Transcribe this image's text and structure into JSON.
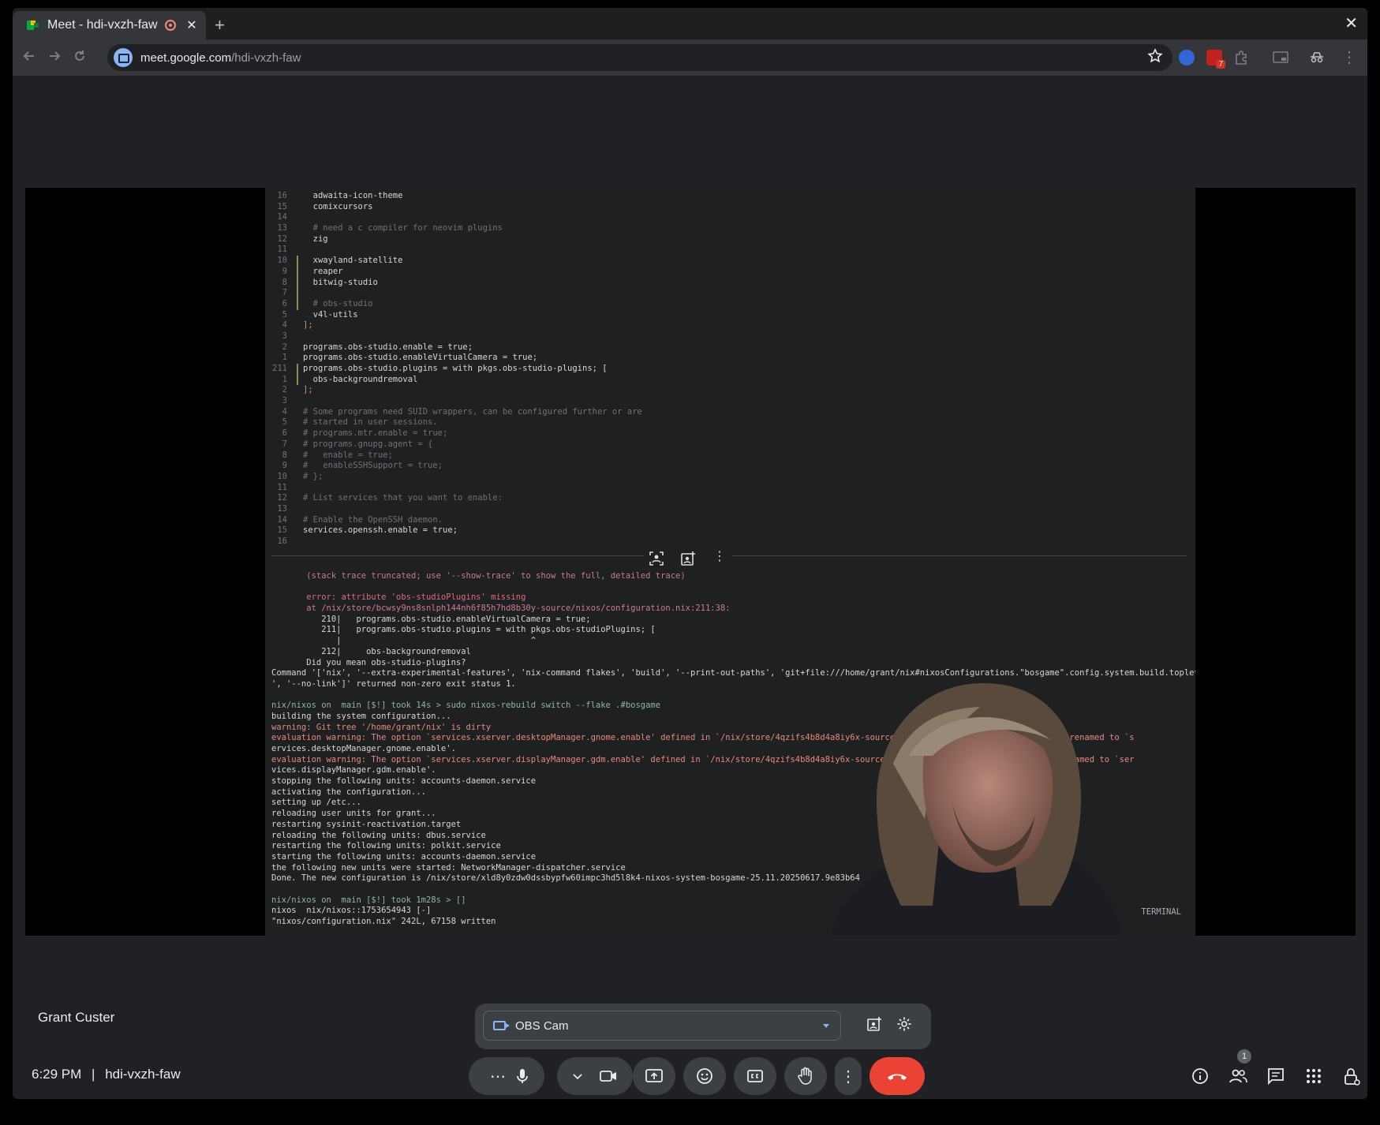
{
  "browser": {
    "tab_title": "Meet - hdi-vxzh-faw",
    "tab_close": "✕",
    "new_tab": "+",
    "window_close": "✕",
    "url_host": "meet.google.com",
    "url_path": "/hdi-vxzh-faw",
    "extension_badge": "7"
  },
  "editor": {
    "lines": [
      {
        "n": "16",
        "t": "  adwaita-icon-theme",
        "c": "",
        "m": false
      },
      {
        "n": "15",
        "t": "  comixcursors",
        "c": "",
        "m": false
      },
      {
        "n": "14",
        "t": "",
        "c": "",
        "m": false
      },
      {
        "n": "13",
        "t": "  # need a c compiler for neovim plugins",
        "c": "comment",
        "m": false
      },
      {
        "n": "12",
        "t": "  zig",
        "c": "",
        "m": false
      },
      {
        "n": "11",
        "t": "",
        "c": "",
        "m": false
      },
      {
        "n": "10",
        "t": "  xwayland-satellite",
        "c": "",
        "m": true
      },
      {
        "n": "9",
        "t": "  reaper",
        "c": "",
        "m": true
      },
      {
        "n": "8",
        "t": "  bitwig-studio",
        "c": "",
        "m": true
      },
      {
        "n": "7",
        "t": "",
        "c": "",
        "m": true
      },
      {
        "n": "6",
        "t": "  # obs-studio",
        "c": "comment",
        "m": true
      },
      {
        "n": "5",
        "t": "  v4l-utils",
        "c": "",
        "m": false
      },
      {
        "n": "4",
        "t": "];",
        "c": "kw",
        "m": false
      },
      {
        "n": "3",
        "t": "",
        "c": "",
        "m": false
      },
      {
        "n": "2",
        "t": "programs.obs-studio.enable = true;",
        "c": "",
        "m": false
      },
      {
        "n": "1",
        "t": "programs.obs-studio.enableVirtualCamera = true;",
        "c": "",
        "m": false
      },
      {
        "n": "211",
        "t": "programs.obs-studio.plugins = with pkgs.obs-studio-plugins; [",
        "c": "",
        "m": true
      },
      {
        "n": "1",
        "t": "  obs-backgroundremoval",
        "c": "",
        "m": true
      },
      {
        "n": "2",
        "t": "];",
        "c": "kw",
        "m": false
      },
      {
        "n": "3",
        "t": "",
        "c": "",
        "m": false
      },
      {
        "n": "4",
        "t": "# Some programs need SUID wrappers, can be configured further or are",
        "c": "comment",
        "m": false
      },
      {
        "n": "5",
        "t": "# started in user sessions.",
        "c": "comment",
        "m": false
      },
      {
        "n": "6",
        "t": "# programs.mtr.enable = true;",
        "c": "comment",
        "m": false
      },
      {
        "n": "7",
        "t": "# programs.gnupg.agent = {",
        "c": "comment",
        "m": false
      },
      {
        "n": "8",
        "t": "#   enable = true;",
        "c": "comment",
        "m": false
      },
      {
        "n": "9",
        "t": "#   enableSSHSupport = true;",
        "c": "comment",
        "m": false
      },
      {
        "n": "10",
        "t": "# };",
        "c": "comment",
        "m": false
      },
      {
        "n": "11",
        "t": "",
        "c": "",
        "m": false
      },
      {
        "n": "12",
        "t": "# List services that you want to enable:",
        "c": "comment",
        "m": false
      },
      {
        "n": "13",
        "t": "",
        "c": "",
        "m": false
      },
      {
        "n": "14",
        "t": "# Enable the OpenSSH daemon.",
        "c": "comment",
        "m": false
      },
      {
        "n": "15",
        "t": "services.openssh.enable = true;",
        "c": "",
        "m": false
      },
      {
        "n": "16",
        "t": "",
        "c": "",
        "m": false
      }
    ]
  },
  "terminal": {
    "label": "TERMINAL",
    "lines": [
      {
        "t": "       (stack trace truncated; use '--show-trace' to show the full, detailed trace)",
        "c": "trunc"
      },
      {
        "t": "",
        "c": ""
      },
      {
        "t": "       error: attribute 'obs-studioPlugins' missing",
        "c": "err"
      },
      {
        "t": "       at /nix/store/bcwsy9ns8snlph144nh6f85h7hd8b30y-source/nixos/configuration.nix:211:38:",
        "c": "path"
      },
      {
        "t": "          210|   programs.obs-studio.enableVirtualCamera = true;",
        "c": ""
      },
      {
        "t": "          211|   programs.obs-studio.plugins = with pkgs.obs-studioPlugins; [",
        "c": ""
      },
      {
        "t": "             |                                      ^",
        "c": ""
      },
      {
        "t": "          212|     obs-backgroundremoval",
        "c": ""
      },
      {
        "t": "       Did you mean obs-studio-plugins?",
        "c": ""
      },
      {
        "t": "Command '['nix', '--extra-experimental-features', 'nix-command flakes', 'build', '--print-out-paths', 'git+file:///home/grant/nix#nixosConfigurations.\"bosgame\".config.system.build.toplevel",
        "c": ""
      },
      {
        "t": "', '--no-link']' returned non-zero exit status 1.",
        "c": ""
      },
      {
        "t": "",
        "c": ""
      },
      {
        "t": "nix/nixos on  main [$!] took 14s > sudo nixos-rebuild switch --flake .#bosgame",
        "c": "prompt"
      },
      {
        "t": "building the system configuration...",
        "c": ""
      },
      {
        "t": "warning: Git tree '/home/grant/nix' is dirty",
        "c": "warn"
      },
      {
        "t": "evaluation warning: The option `services.xserver.desktopManager.gnome.enable' defined in `/nix/store/4qzifs4b8d4a8iy6x-source/nixos/configuration.nix' has been renamed to `s",
        "c": "warn"
      },
      {
        "t": "ervices.desktopManager.gnome.enable'.",
        "c": ""
      },
      {
        "t": "evaluation warning: The option `services.xserver.displayManager.gdm.enable' defined in `/nix/store/4qzifs4b8d4a8iy6x-source/nixos/configuration.nix' has been renamed to `ser",
        "c": "warn"
      },
      {
        "t": "vices.displayManager.gdm.enable'.",
        "c": ""
      },
      {
        "t": "stopping the following units: accounts-daemon.service",
        "c": ""
      },
      {
        "t": "activating the configuration...",
        "c": ""
      },
      {
        "t": "setting up /etc...",
        "c": ""
      },
      {
        "t": "reloading user units for grant...",
        "c": ""
      },
      {
        "t": "restarting sysinit-reactivation.target",
        "c": ""
      },
      {
        "t": "reloading the following units: dbus.service",
        "c": ""
      },
      {
        "t": "restarting the following units: polkit.service",
        "c": ""
      },
      {
        "t": "starting the following units: accounts-daemon.service",
        "c": ""
      },
      {
        "t": "the following new units were started: NetworkManager-dispatcher.service",
        "c": ""
      },
      {
        "t": "Done. The new configuration is /nix/store/xld8y0zdw0dssbypfw60impc3hd5l8k4-nixos-system-bosgame-25.11.20250617.9e83b64",
        "c": ""
      },
      {
        "t": "",
        "c": ""
      },
      {
        "t": "nix/nixos on  main [$!] took 1m28s > []",
        "c": "prompt"
      },
      {
        "t": "nixos  nix/nixos::1753654943 [-]",
        "c": ""
      },
      {
        "t": "\"nixos/configuration.nix\" 242L, 67158 written",
        "c": ""
      }
    ]
  },
  "participant": {
    "name": "Grant Custer"
  },
  "camera": {
    "selected": "OBS Cam"
  },
  "meeting": {
    "time": "6:29 PM",
    "separator": "|",
    "code": "hdi-vxzh-faw",
    "participants_count": "1"
  },
  "icons": {
    "more_options": "⋯",
    "kebab": "⋮"
  }
}
